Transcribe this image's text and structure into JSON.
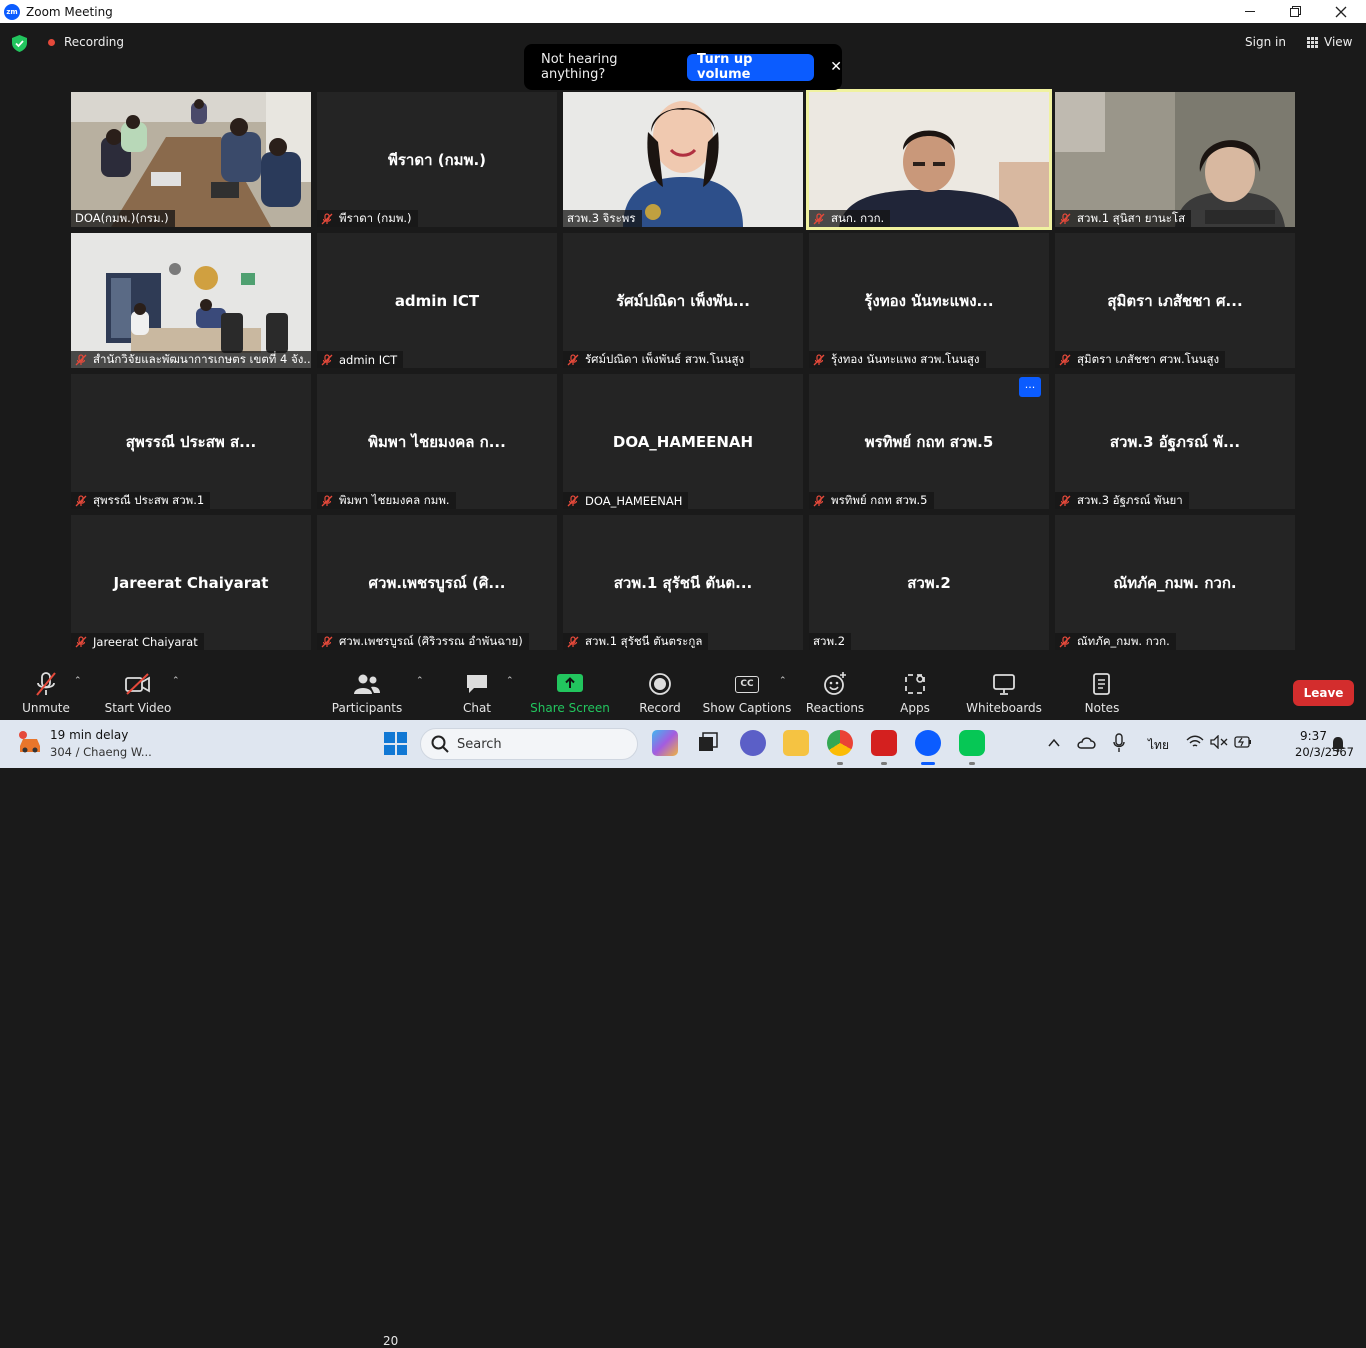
{
  "window": {
    "title": "Zoom Meeting",
    "app_icon": "zoom-logo",
    "logo_text": "zm"
  },
  "header": {
    "recording_label": "Recording",
    "sign_in_label": "Sign in",
    "view_label": "View",
    "colors": {
      "recording": "#e5493a",
      "shield": "#22c55e"
    }
  },
  "toast": {
    "message": "Not hearing anything?",
    "button_label": "Turn up volume",
    "close": "✕"
  },
  "tiles": [
    {
      "center": "",
      "plate": "DOA(กมพ.)(กรม.)",
      "muted": false,
      "video": "room-meeting"
    },
    {
      "center": "พีราดา (กมพ.)",
      "plate": "พีราดา (กมพ.)",
      "muted": true,
      "video": ""
    },
    {
      "center": "",
      "plate": "สวพ.3 จิระพร",
      "muted": false,
      "video": "woman-smiling"
    },
    {
      "center": "",
      "plate": "สนก. กวก.",
      "muted": true,
      "video": "man-desk",
      "active": true
    },
    {
      "center": "",
      "plate": "สวพ.1 สุนิสา ยานะโส",
      "muted": true,
      "video": "woman-laptop"
    },
    {
      "center": "",
      "plate": "สำนักวิจัยและพัฒนาการเกษตร เขตที่ 4 จัง...",
      "muted": true,
      "video": "office-room"
    },
    {
      "center": "admin ICT",
      "plate": "admin ICT",
      "muted": true,
      "video": ""
    },
    {
      "center": "รัศม์ปณิดา เพ็งพัน...",
      "plate": "รัศม์ปณิดา เพ็งพันธ์ สวพ.โนนสูง",
      "muted": true,
      "video": ""
    },
    {
      "center": "รุ้งทอง นันทะแพง...",
      "plate": "รุ้งทอง นันทะแพง สวพ.โนนสูง",
      "muted": true,
      "video": ""
    },
    {
      "center": "สุมิตรา เภสัชชา ศ...",
      "plate": "สุมิตรา เภสัชชา ศวพ.โนนสูง",
      "muted": true,
      "video": ""
    },
    {
      "center": "สุพรรณี ประสพ  ส...",
      "plate": "สุพรรณี ประสพ  สวพ.1",
      "muted": true,
      "video": ""
    },
    {
      "center": "พิมพา ไชยมงคล ก...",
      "plate": "พิมพา ไชยมงคล กมพ.",
      "muted": true,
      "video": ""
    },
    {
      "center": "DOA_HAMEENAH",
      "plate": "DOA_HAMEENAH",
      "muted": true,
      "video": ""
    },
    {
      "center": "พรทิพย์ กถท สวพ.5",
      "plate": "พรทิพย์ กถท สวพ.5",
      "muted": true,
      "video": "",
      "more": "···"
    },
    {
      "center": "สวพ.3 อัฐภรณ์ พั...",
      "plate": "สวพ.3 อัฐภรณ์ พันยา",
      "muted": true,
      "video": ""
    },
    {
      "center": "Jareerat Chaiyarat",
      "plate": "Jareerat Chaiyarat",
      "muted": true,
      "video": ""
    },
    {
      "center": "ศวพ.เพชรบูรณ์ (ศิ...",
      "plate": "ศวพ.เพชรบูรณ์ (ศิริวรรณ อำพันฉาย)",
      "muted": true,
      "video": ""
    },
    {
      "center": "สวพ.1 สุรัชนี ตันต...",
      "plate": "สวพ.1 สุรัชนี ตันตระกูล",
      "muted": true,
      "video": ""
    },
    {
      "center": "สวพ.2",
      "plate": "สวพ.2",
      "muted": false,
      "video": ""
    },
    {
      "center": "ณัทภัค_กมพ. กวก.",
      "plate": "ณัทภัค_กมพ. กวก.",
      "muted": true,
      "video": ""
    }
  ],
  "toolbar": {
    "unmute": "Unmute",
    "start_video": "Start Video",
    "participants": "Participants",
    "participant_count": "20",
    "chat": "Chat",
    "share_screen": "Share Screen",
    "record": "Record",
    "show_captions": "Show Captions",
    "captions_badge": "CC",
    "reactions": "Reactions",
    "apps": "Apps",
    "whiteboards": "Whiteboards",
    "notes": "Notes",
    "leave": "Leave",
    "caret": "⌃",
    "colors": {
      "share": "#22c55e",
      "leave": "#d32d2d",
      "mute_slash": "#e5493a"
    }
  },
  "taskbar": {
    "weather_line1": "19 min delay",
    "weather_line2": "304 / Chaeng W...",
    "search_label": "Search",
    "lang": "ไทย",
    "time": "9:37",
    "date": "20/3/2567",
    "apps": [
      "copilot-icon",
      "taskview-icon",
      "teams-icon",
      "file-explorer-icon",
      "chrome-icon",
      "acrobat-icon",
      "zoom-icon",
      "line-icon"
    ]
  }
}
